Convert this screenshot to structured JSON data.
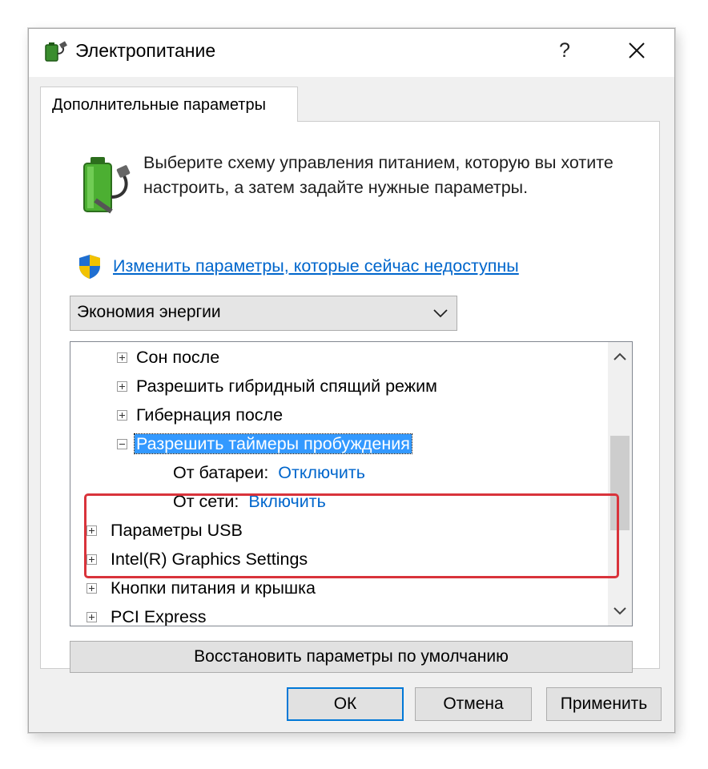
{
  "window": {
    "title": "Электропитание",
    "help_label": "?",
    "tab_label": "Дополнительные параметры"
  },
  "content": {
    "description": "Выберите схему управления питанием, которую вы хотите настроить, а затем задайте нужные параметры.",
    "change_link": "Изменить параметры, которые сейчас недоступны",
    "plan_dropdown": {
      "selected": "Экономия энергии"
    }
  },
  "tree": {
    "items": [
      {
        "label": "Сон после",
        "expander": "plus"
      },
      {
        "label": "Разрешить гибридный спящий режим",
        "expander": "plus"
      },
      {
        "label": "Гибернация после",
        "expander": "plus"
      },
      {
        "label": "Разрешить таймеры пробуждения",
        "expander": "minus",
        "selected": true
      },
      {
        "label": "От батареи:",
        "value": "Отключить"
      },
      {
        "label": "От сети:",
        "value": "Включить"
      },
      {
        "label": "Параметры USB",
        "expander": "plus"
      },
      {
        "label": "Intel(R) Graphics Settings",
        "expander": "plus"
      },
      {
        "label": "Кнопки питания и крышка",
        "expander": "plus"
      },
      {
        "label": "PCI Express",
        "expander": "plus"
      }
    ]
  },
  "buttons": {
    "restore": "Восстановить параметры по умолчанию",
    "ok": "ОК",
    "cancel": "Отмена",
    "apply": "Применить"
  },
  "colors": {
    "accent": "#0078d7",
    "link": "#0066cc",
    "selection": "#3399ff",
    "highlight_frame": "#d9333b"
  },
  "icons": {
    "title": "power-plug-icon",
    "battery": "battery-plug-icon",
    "shield": "uac-shield-icon",
    "dropdown": "chevron-down-icon",
    "close": "close-icon",
    "scroll_up": "chevron-up-icon",
    "scroll_down": "chevron-down-icon"
  }
}
